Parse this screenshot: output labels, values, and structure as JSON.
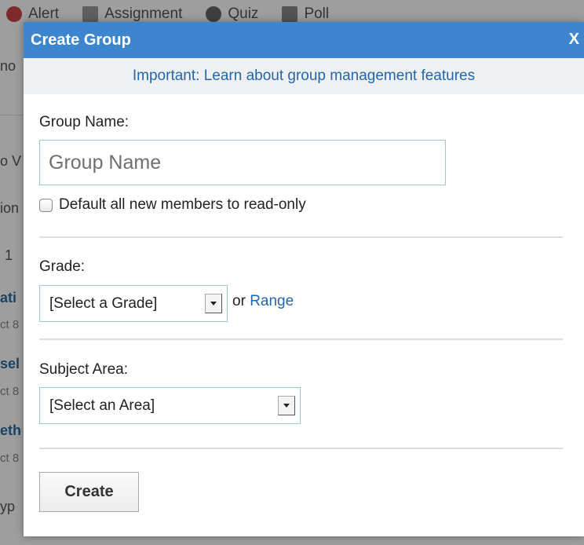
{
  "background": {
    "toolbar": [
      "Alert",
      "Assignment",
      "Quiz",
      "Poll"
    ],
    "left_fragments": [
      "no",
      "o V",
      "ion",
      "1",
      "ati",
      "ct 8",
      "sel",
      "ct 8",
      "eth",
      "ct 8",
      "yp"
    ]
  },
  "dialog": {
    "title": "Create Group",
    "close_label": "X",
    "notice": "Important: Learn about group management features",
    "group_name_label": "Group Name:",
    "group_name_placeholder": "Group Name",
    "group_name_value": "",
    "readonly_label": "Default all new members to read-only",
    "readonly_checked": false,
    "grade_label": "Grade:",
    "grade_selected": "[Select a Grade]",
    "or_text": "or",
    "range_link": "Range",
    "subject_label": "Subject Area:",
    "subject_selected": "[Select an Area]",
    "create_label": "Create"
  },
  "colors": {
    "header": "#3d86cf",
    "link": "#2566a8",
    "notice_bg": "#eef0f2",
    "input_border": "#9bc4e6"
  }
}
